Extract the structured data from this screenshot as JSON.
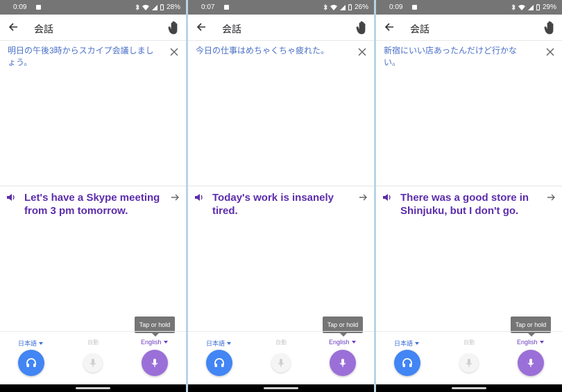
{
  "screens": [
    {
      "status": {
        "time": "0:09",
        "battery": "28%"
      },
      "title": "会話",
      "source_text": "明日の午後3時からスカイプ会議しましょう。",
      "translation": "Let's have a Skype meeting from 3 pm tomorrow.",
      "tooltip": "Tap or hold",
      "lang_left": "日本語",
      "lang_mid": "自動",
      "lang_right": "English"
    },
    {
      "status": {
        "time": "0:07",
        "battery": "26%"
      },
      "title": "会話",
      "source_text": "今日の仕事はめちゃくちゃ疲れた。",
      "translation": "Today's work is insanely tired.",
      "tooltip": "Tap or hold",
      "lang_left": "日本語",
      "lang_mid": "自動",
      "lang_right": "English"
    },
    {
      "status": {
        "time": "0:09",
        "battery": "29%"
      },
      "title": "会話",
      "source_text": "新宿にいい店あったんだけど行かない。",
      "translation": "There was a good store in Shinjuku, but I don't go.",
      "tooltip": "Tap or hold",
      "lang_left": "日本語",
      "lang_mid": "自動",
      "lang_right": "English"
    }
  ],
  "icons": {
    "back": "arrow-left-icon",
    "hand": "hand-icon",
    "close": "close-icon",
    "speaker": "speaker-icon",
    "forward": "arrow-right-icon",
    "headphones": "headphones-icon",
    "mic": "mic-icon"
  },
  "colors": {
    "source_text": "#4a6fc8",
    "translation_text": "#5c2dab",
    "left_button": "#4285f4",
    "right_button": "#9b6fd8",
    "status_bar": "#757575"
  }
}
